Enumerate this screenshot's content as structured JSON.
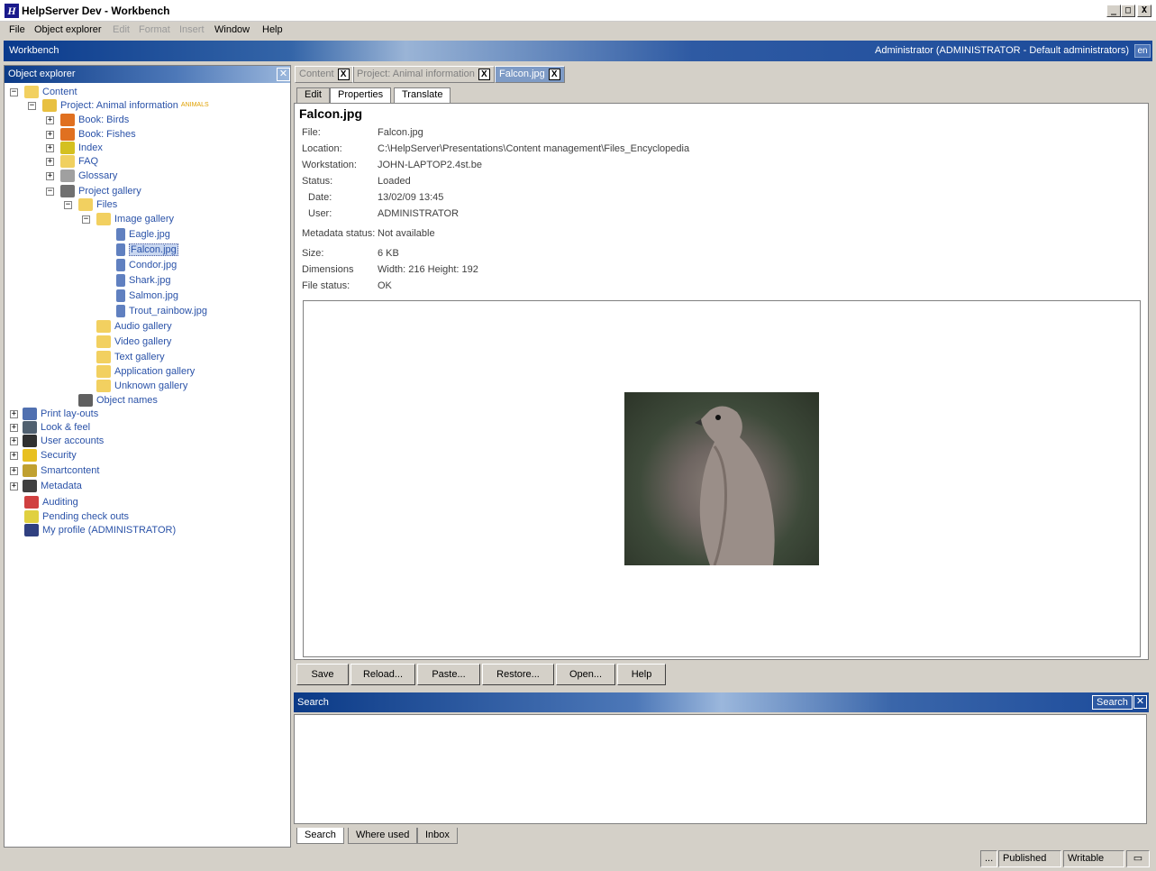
{
  "window": {
    "title": "HelpServer Dev - Workbench",
    "min": "_",
    "max": "□",
    "close": "X"
  },
  "menu": [
    {
      "label": "File",
      "enabled": true
    },
    {
      "label": "Object explorer",
      "enabled": true
    },
    {
      "label": "Edit",
      "enabled": false
    },
    {
      "label": "Format",
      "enabled": false
    },
    {
      "label": "Insert",
      "enabled": false
    },
    {
      "label": "Window",
      "enabled": true
    },
    {
      "label": "Help",
      "enabled": true
    }
  ],
  "workbench": {
    "title": "Workbench",
    "user": "Administrator (ADMINISTRATOR - Default administrators)",
    "lang": "en"
  },
  "explorer": {
    "title": "Object explorer",
    "tree": [
      {
        "label": "Content",
        "exp": "−",
        "color": "#f2d060"
      },
      {
        "label": "Project: Animal information",
        "exp": "−",
        "tag": "ANIMALS",
        "color": "#e8c040"
      },
      {
        "label": "Book: Birds",
        "exp": "+",
        "color": "#e07020"
      },
      {
        "label": "Book: Fishes",
        "exp": "+",
        "color": "#e07020"
      },
      {
        "label": "Index",
        "exp": "+",
        "color": "#d4c020"
      },
      {
        "label": "FAQ",
        "exp": "+",
        "color": "#f0d060"
      },
      {
        "label": "Glossary",
        "exp": "+",
        "color": "#a0a0a0"
      },
      {
        "label": "Project gallery",
        "exp": "−",
        "color": "#707070"
      },
      {
        "label": "Files",
        "exp": "−",
        "color": "#f2d060"
      },
      {
        "label": "Image gallery",
        "exp": "−",
        "color": "#f2d060"
      },
      {
        "label": "Eagle.jpg",
        "color": "#6080c0"
      },
      {
        "label": "Falcon.jpg",
        "color": "#6080c0",
        "selected": true
      },
      {
        "label": "Condor.jpg",
        "color": "#6080c0"
      },
      {
        "label": "Shark.jpg",
        "color": "#6080c0"
      },
      {
        "label": "Salmon.jpg",
        "color": "#6080c0"
      },
      {
        "label": "Trout_rainbow.jpg",
        "color": "#6080c0"
      },
      {
        "label": "Audio gallery",
        "color": "#f2d060"
      },
      {
        "label": "Video gallery",
        "color": "#f2d060"
      },
      {
        "label": "Text gallery",
        "color": "#f2d060"
      },
      {
        "label": "Application gallery",
        "color": "#f2d060"
      },
      {
        "label": "Unknown gallery",
        "color": "#f2d060"
      },
      {
        "label": "Object names",
        "color": "#606060"
      },
      {
        "label": "Print lay-outs",
        "exp": "+",
        "color": "#5070b0"
      },
      {
        "label": "Look & feel",
        "exp": "+",
        "color": "#506070"
      },
      {
        "label": "User accounts",
        "exp": "+",
        "color": "#303030"
      },
      {
        "label": "Security",
        "exp": "+",
        "color": "#e8c020"
      },
      {
        "label": "Smartcontent",
        "exp": "+",
        "color": "#c0a030"
      },
      {
        "label": "Metadata",
        "exp": "+",
        "color": "#404040"
      },
      {
        "label": "Auditing",
        "color": "#d04040"
      },
      {
        "label": "Pending check outs",
        "color": "#e0d040"
      },
      {
        "label": "My profile (ADMINISTRATOR)",
        "color": "#304080"
      }
    ]
  },
  "doctabs": [
    {
      "label": "Content",
      "close": false
    },
    {
      "label": "Project: Animal information",
      "close": true
    },
    {
      "label": "Falcon.jpg",
      "close": true,
      "active": true
    }
  ],
  "subtabs": [
    "Edit",
    "Properties",
    "Translate"
  ],
  "props": {
    "title": "Falcon.jpg",
    "fields": [
      {
        "label": "File:",
        "value": "Falcon.jpg"
      },
      {
        "label": "Location:",
        "value": "C:\\HelpServer\\Presentations\\Content management\\Files_Encyclopedia"
      },
      {
        "label": "Workstation:",
        "value": "JOHN-LAPTOP2.4st.be"
      },
      {
        "label": "Status:",
        "value": "Loaded"
      },
      {
        "label": "Date:",
        "value": "13/02/09 13:45"
      },
      {
        "label": "User:",
        "value": "ADMINISTRATOR"
      },
      {
        "label": "Metadata status:",
        "value": "Not available"
      },
      {
        "label": "Size:",
        "value": "6 KB"
      },
      {
        "label": "Dimensions",
        "value": "Width: 216 Height: 192"
      },
      {
        "label": "File status:",
        "value": "OK"
      }
    ]
  },
  "buttons": [
    "Save",
    "Reload...",
    "Paste...",
    "Restore...",
    "Open...",
    "Help"
  ],
  "search": {
    "title": "Search",
    "button": "Search",
    "tabs": [
      "Search",
      "Where used",
      "Inbox"
    ]
  },
  "status": {
    "dots": "...",
    "published": "Published",
    "writable": "Writable"
  }
}
